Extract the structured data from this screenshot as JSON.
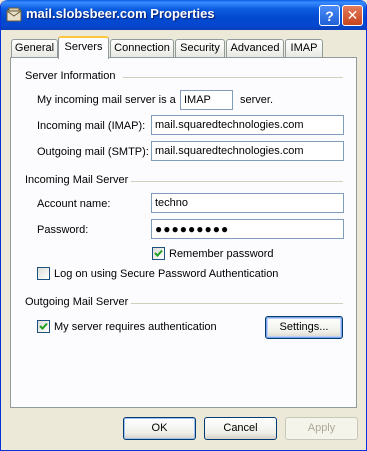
{
  "window": {
    "title": "mail.slobsbeer.com Properties",
    "help_label": "?",
    "close_label": "✕"
  },
  "tabs": [
    {
      "label": "General"
    },
    {
      "label": "Servers"
    },
    {
      "label": "Connection"
    },
    {
      "label": "Security"
    },
    {
      "label": "Advanced"
    },
    {
      "label": "IMAP"
    }
  ],
  "server_info": {
    "group_label": "Server Information",
    "incoming_type_prefix": "My incoming mail server is a",
    "incoming_type_value": "IMAP",
    "incoming_type_suffix": "server.",
    "incoming_label": "Incoming mail (IMAP):",
    "incoming_value": "mail.squaredtechnologies.com",
    "outgoing_label": "Outgoing mail (SMTP):",
    "outgoing_value": "mail.squaredtechnologies.com"
  },
  "incoming_server": {
    "group_label": "Incoming Mail Server",
    "account_label": "Account name:",
    "account_value": "techno",
    "password_label": "Password:",
    "password_value": "●●●●●●●●●",
    "remember_label": "Remember password",
    "remember_checked": true,
    "spa_label": "Log on using Secure Password Authentication",
    "spa_checked": false
  },
  "outgoing_server": {
    "group_label": "Outgoing Mail Server",
    "auth_label": "My server requires authentication",
    "auth_checked": true,
    "settings_label": "Settings..."
  },
  "footer": {
    "ok_label": "OK",
    "cancel_label": "Cancel",
    "apply_label": "Apply"
  }
}
